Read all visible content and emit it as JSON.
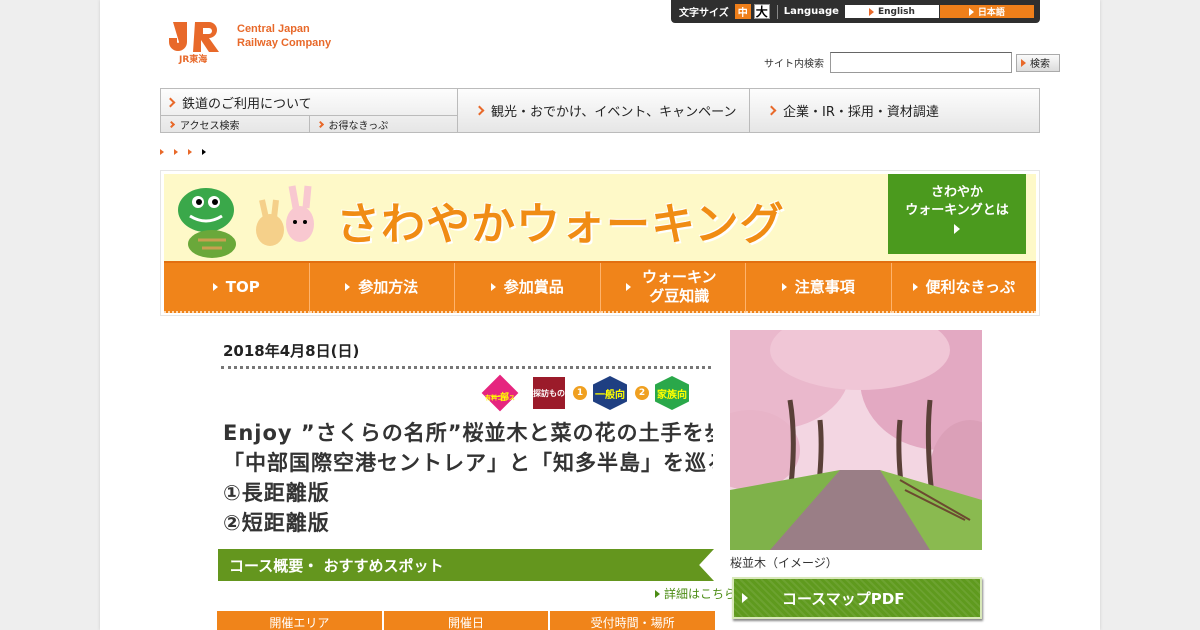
{
  "utility": {
    "font_size_label": "文字サイズ",
    "font_mid": "中",
    "font_big": "大",
    "language_label": "Language",
    "lang_en": "English",
    "lang_ja": "日本語"
  },
  "logo": {
    "mark_text": "JR東海",
    "line1": "Central Japan",
    "line2": "Railway Company"
  },
  "search": {
    "label": "サイト内検索",
    "value": "",
    "button": "検索"
  },
  "gnav": {
    "rail_use": "鉄道のご利用について",
    "access": "アクセス検索",
    "tickets": "お得なきっぷ",
    "sightseeing": "観光・おでかけ、イベント、キャンペーン",
    "corporate": "企業・IR・採用・資材調達"
  },
  "banner": {
    "title": "さわやかウォーキング",
    "about_line1": "さわやか",
    "about_line2": "ウォーキングとは"
  },
  "tabs": [
    {
      "label": "TOP"
    },
    {
      "label": "参加方法"
    },
    {
      "label": "参加賞品"
    },
    {
      "label": "ウォーキング豆知識"
    },
    {
      "label": "注意事項"
    },
    {
      "label": "便利なきっぷ"
    }
  ],
  "event": {
    "date": "2018年4月8日(日)",
    "icon_part_line1": "一部",
    "icon_part_line2": "有料コース",
    "icon_tanbo": "探訪もの",
    "icon_num1": "1",
    "icon_general": "一般向",
    "icon_num2": "2",
    "icon_family": "家族向",
    "headline_line1": "Enjoy ”さくらの名所”桜並木と菜の花の土手を歩いて春を満喫",
    "headline_line2": "「中部国際空港セントレア」と「知多半島」を巡るウォーキング",
    "headline_line3": "①長距離版",
    "headline_line4": "②短距離版",
    "course_bar": "コース概要・ おすすめスポット",
    "more_link": "詳細はこちら",
    "table_headers": [
      "開催エリア",
      "開催日",
      "受付時間・場所"
    ]
  },
  "sidebar": {
    "photo_caption": "桜並木（イメージ）",
    "map_button": "コースマップPDF"
  },
  "colors": {
    "accent": "#f0841a",
    "green": "#64961e",
    "jr_orange": "#e8692a"
  }
}
